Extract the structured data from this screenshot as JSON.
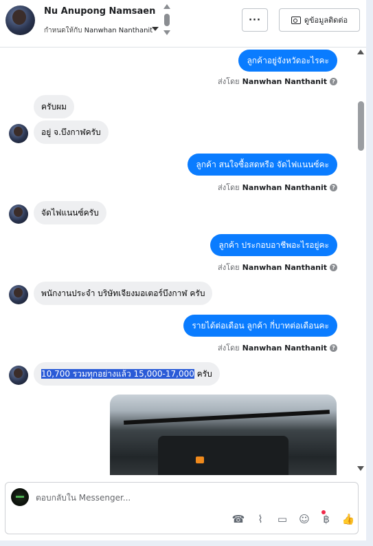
{
  "header": {
    "contact_name": "Nu Anupong Namsaen",
    "assign_prefix": "กำหนดให้กับ",
    "assignee": "Nanwhan Nanthanit",
    "more_label": "···",
    "contact_info_label": "ดูข้อมูลติดต่อ"
  },
  "messages": {
    "sent_by_prefix": "ส่งโดย",
    "sent_by_name": "Nanwhan Nanthanit",
    "help_glyph": "?",
    "out_1": "ลูกค้าอยู่จังหวัดอะไรคะ",
    "in_1a": "ครับผม",
    "in_1b": "อยู่ จ.บึงกาฬครับ",
    "out_2": "ลูกค้า สนใจซื้อสดหรือ จัดไฟแนนซ์คะ",
    "in_2": "จัดไฟแนนซ์ครับ",
    "out_3": "ลูกค้า ประกอบอาชีพอะไรอยู่คะ",
    "in_3": "พนักงานประจำ บริษัทเจียงมอเตอร์บึงกาฬ ครับ",
    "out_4": "รายได้ต่อเดือน ลูกค้า กี่บาทต่อเดือนคะ",
    "in_4_selected": "10,700 รวมทุกอย่างแล้ว 15,000-17,000",
    "in_4_rest": " ครับ"
  },
  "composer": {
    "placeholder": "ตอบกลับใน Messenger..."
  },
  "icons": {
    "call": "☎",
    "attach": "⌇",
    "saved_reply": "▭",
    "emoji": "☺",
    "payment": "฿",
    "like": "👍"
  },
  "colors": {
    "outgoing_bubble": "#0a7cff",
    "incoming_bubble": "#eeeff1",
    "selection": "#2a5bd7",
    "notification_dot": "#f02849"
  }
}
